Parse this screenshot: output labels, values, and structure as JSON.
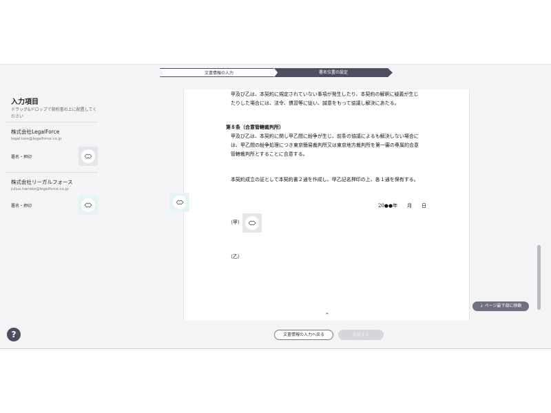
{
  "stepper": {
    "step1": "文書情報の入力",
    "step2": "署名位置の設定"
  },
  "sidebar": {
    "title": "入力項目",
    "description": "ドラッグ&ドロップで契約書の上に配置してください",
    "signers": [
      {
        "company": "株式会社LegalForce",
        "email": "legal.taro@legalforce.co.jp",
        "field_label": "署名・押印"
      },
      {
        "company": "株式会社リーガルフォース",
        "email": "julius.hanako@legalforce.co.jp",
        "field_label": "署名・押印"
      }
    ]
  },
  "document": {
    "lines": [
      "甲及び乙は、本契約に規定されていない事項が発生したり、本契約の解釈に疑義が生じ",
      "たりした場合には、法令、慣習等に従い、誠意をもって協議し解決にあたる。",
      "第８条（合意管轄裁判所）",
      "甲及び乙は、本契約に関し甲乙間に紛争が生じ、前条の協議によるも解決しない場合に",
      "は、甲乙間の紛争処理につき東京簡易裁判所又は東京地方裁判所を第一審の専属的合意",
      "管轄裁判所とすることに合意する。",
      "本契約成立の証として本契約書２通を作成し、甲乙記名押印の上、各１通を保有する。"
    ],
    "date_line": "20●●年　　月　　日",
    "party_a": "（甲）",
    "party_b": "（乙）",
    "page_marker": "^"
  },
  "buttons": {
    "jump_bottom": "ページ最下部に移動",
    "help": "?",
    "back": "文書情報の入力へ戻る",
    "send": "送信する"
  },
  "icons": {
    "stamp": "handshake-icon",
    "jump": "arrow-down-icon",
    "help": "question-icon"
  }
}
